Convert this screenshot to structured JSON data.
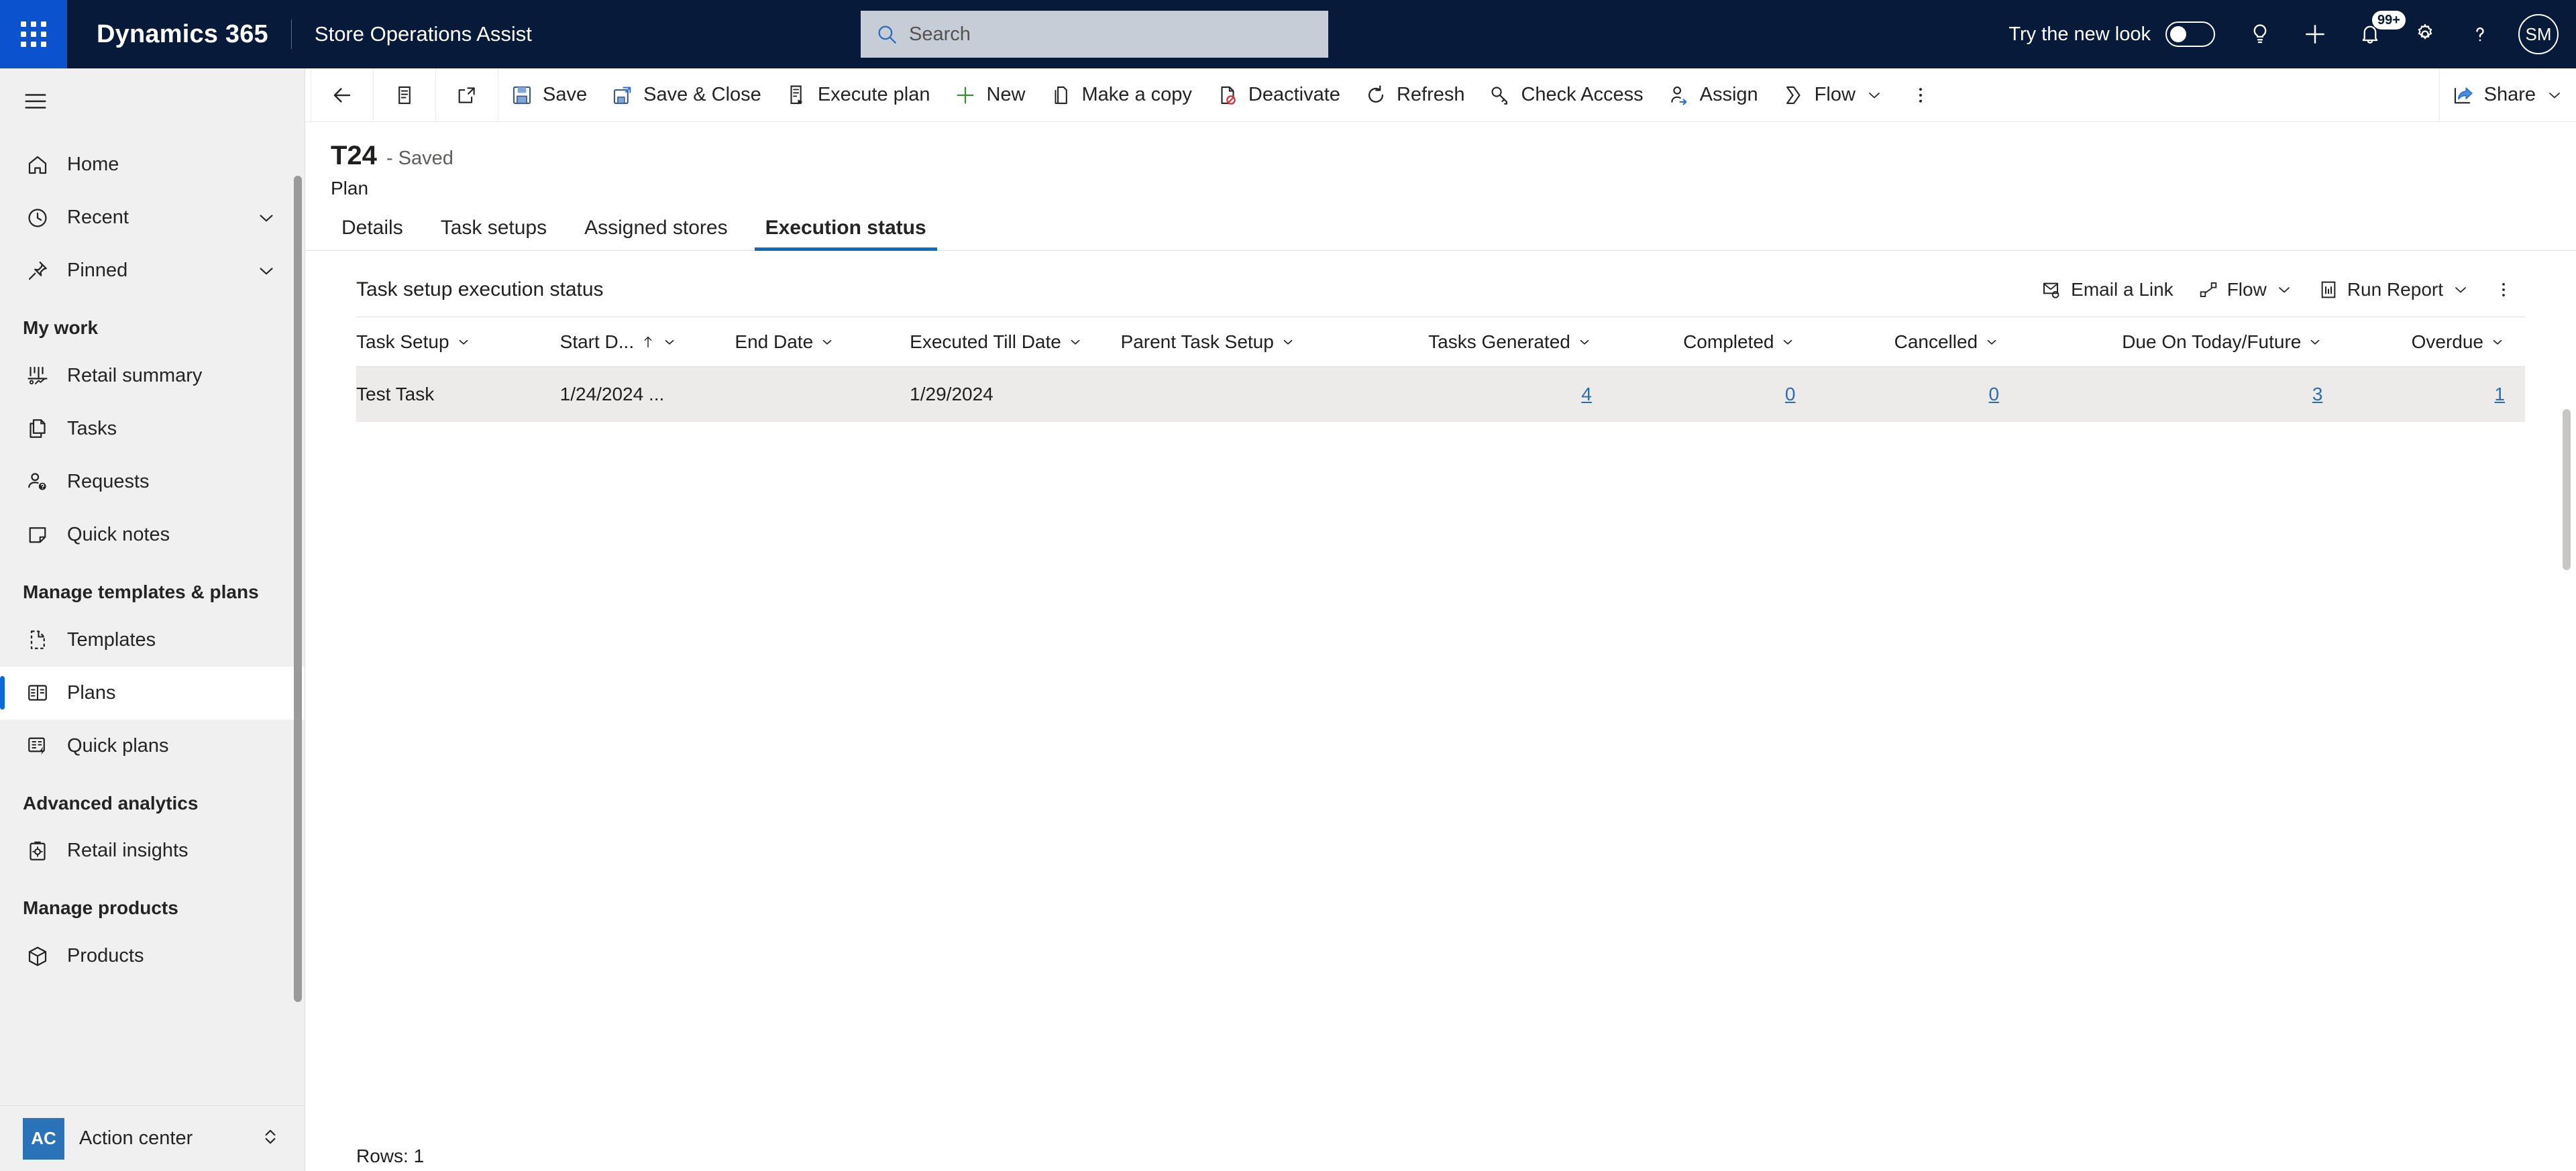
{
  "header": {
    "waffle_icon": "waffle-grid-icon",
    "brand": "Dynamics 365",
    "app_name": "Store Operations Assist",
    "search": {
      "placeholder": "Search",
      "value": "",
      "icon": "search-icon"
    },
    "new_look_label": "Try the new look",
    "new_look_enabled": false,
    "icons": [
      {
        "name": "lightbulb-icon"
      },
      {
        "name": "plus-icon"
      },
      {
        "name": "bell-icon",
        "badge": "99+"
      },
      {
        "name": "gear-icon"
      },
      {
        "name": "help-icon"
      }
    ],
    "avatar_initials": "SM"
  },
  "sidebar": {
    "hamburger_icon": "hamburger-icon",
    "items": [
      {
        "label": "Home",
        "icon": "home-icon",
        "chevron": false,
        "selected": false
      },
      {
        "label": "Recent",
        "icon": "clock-icon",
        "chevron": true,
        "selected": false
      },
      {
        "label": "Pinned",
        "icon": "pin-icon",
        "chevron": true,
        "selected": false
      }
    ],
    "groups": [
      {
        "title": "My work",
        "items": [
          {
            "label": "Retail summary",
            "icon": "analytics-icon",
            "selected": false
          },
          {
            "label": "Tasks",
            "icon": "tasks-icon",
            "selected": false
          },
          {
            "label": "Requests",
            "icon": "requests-icon",
            "selected": false
          },
          {
            "label": "Quick notes",
            "icon": "note-icon",
            "selected": false
          }
        ]
      },
      {
        "title": "Manage templates & plans",
        "items": [
          {
            "label": "Templates",
            "icon": "template-icon",
            "selected": false
          },
          {
            "label": "Plans",
            "icon": "plans-icon",
            "selected": true
          },
          {
            "label": "Quick plans",
            "icon": "quick-plans-icon",
            "selected": false
          }
        ]
      },
      {
        "title": "Advanced analytics",
        "items": [
          {
            "label": "Retail insights",
            "icon": "insights-icon",
            "selected": false
          }
        ]
      },
      {
        "title": "Manage products",
        "items": [
          {
            "label": "Products",
            "icon": "product-icon",
            "selected": false
          }
        ]
      }
    ],
    "footer": {
      "badge": "AC",
      "label": "Action center",
      "chevron_icon": "chevron-updown-icon"
    }
  },
  "commandbar": {
    "back_icon": "back-arrow-icon",
    "form_icon": "form-list-icon",
    "popout_icon": "pop-out-icon",
    "buttons": [
      {
        "label": "Save",
        "icon": "save-icon"
      },
      {
        "label": "Save & Close",
        "icon": "save-close-icon"
      },
      {
        "label": "Execute plan",
        "icon": "execute-plan-icon"
      },
      {
        "label": "New",
        "icon": "plus-icon"
      },
      {
        "label": "Make a copy",
        "icon": "copy-icon"
      },
      {
        "label": "Deactivate",
        "icon": "deactivate-icon"
      },
      {
        "label": "Refresh",
        "icon": "refresh-icon"
      },
      {
        "label": "Check Access",
        "icon": "key-icon"
      },
      {
        "label": "Assign",
        "icon": "assign-person-icon"
      },
      {
        "label": "Flow",
        "icon": "flow-icon",
        "chevron": true
      }
    ],
    "overflow_icon": "more-vertical-icon",
    "share": {
      "label": "Share",
      "icon": "share-icon",
      "chevron": true
    }
  },
  "record": {
    "title": "T24",
    "saved_status": "- Saved",
    "entity": "Plan",
    "tabs": [
      {
        "label": "Details",
        "active": false
      },
      {
        "label": "Task setups",
        "active": false
      },
      {
        "label": "Assigned stores",
        "active": false
      },
      {
        "label": "Execution status",
        "active": true
      }
    ]
  },
  "grid": {
    "title": "Task setup execution status",
    "tools": [
      {
        "label": "Email a Link",
        "icon": "email-link-icon",
        "chevron": false
      },
      {
        "label": "Flow",
        "icon": "flow-icon",
        "chevron": true
      },
      {
        "label": "Run Report",
        "icon": "run-report-icon",
        "chevron": true
      }
    ],
    "overflow_icon": "more-vertical-icon",
    "columns": [
      {
        "label": "Task Setup",
        "sort": "",
        "align": "left"
      },
      {
        "label": "Start D...",
        "sort": "asc",
        "align": "left"
      },
      {
        "label": "End Date",
        "sort": "",
        "align": "left"
      },
      {
        "label": "Executed Till Date",
        "sort": "",
        "align": "left"
      },
      {
        "label": "Parent Task Setup",
        "sort": "",
        "align": "left"
      },
      {
        "label": "Tasks Generated",
        "sort": "",
        "align": "right"
      },
      {
        "label": "Completed",
        "sort": "",
        "align": "right"
      },
      {
        "label": "Cancelled",
        "sort": "",
        "align": "right"
      },
      {
        "label": "Due On Today/Future",
        "sort": "",
        "align": "right"
      },
      {
        "label": "Overdue",
        "sort": "",
        "align": "right"
      }
    ],
    "rows": [
      {
        "task_setup": "Test Task",
        "start_date": "1/24/2024 ...",
        "end_date": "",
        "executed_till_date": "1/29/2024",
        "parent_task_setup": "",
        "tasks_generated": "4",
        "completed": "0",
        "cancelled": "0",
        "due_on_today_future": "3",
        "overdue": "1"
      }
    ],
    "rows_footer": "Rows: 1"
  },
  "colors": {
    "header_bg": "#071A39",
    "waffle_bg": "#0B53CE",
    "accent": "#0F6CBD",
    "link": "#2A6DB5",
    "row_bg": "#EDEBE9",
    "sidebar_bg": "#F0F0F0"
  }
}
